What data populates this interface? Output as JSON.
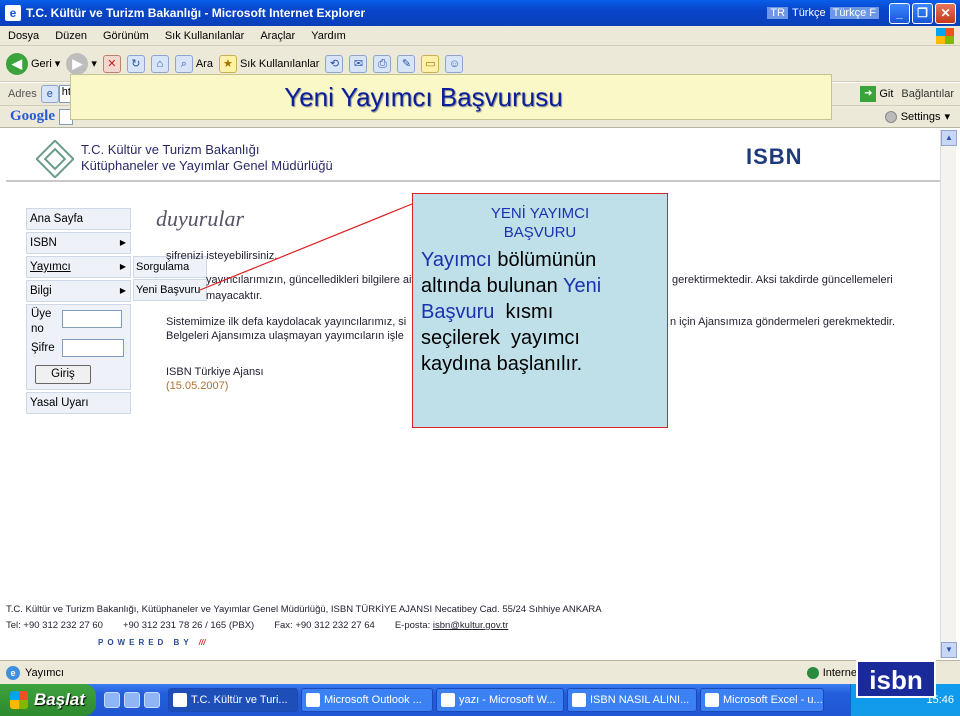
{
  "window": {
    "title": "T.C. Kültür ve Turizm Bakanlığı - Microsoft Internet Explorer",
    "lang_code": "TR",
    "lang_name": "Türkçe",
    "lang_kb": "Türkçe F"
  },
  "menu": [
    "Dosya",
    "Düzen",
    "Görünüm",
    "Sık Kullanılanlar",
    "Araçlar",
    "Yardım"
  ],
  "toolbar": {
    "back": "Geri",
    "search": "Ara",
    "favorites": "Sık Kullanılanlar"
  },
  "address": {
    "label": "Adres",
    "value": "ht",
    "go": "Git",
    "links": "Bağlantılar"
  },
  "google": {
    "logo": "Google",
    "settings": "Settings"
  },
  "banner": {
    "title": "Yeni Yayımcı Başvurusu"
  },
  "site": {
    "ministry_line1": "T.C. Kültür ve Turizm Bakanlığı",
    "ministry_line2": "Kütüphaneler ve Yayımlar Genel Müdürlüğü",
    "isbn": "ISBN"
  },
  "nav": [
    {
      "label": "Ana Sayfa",
      "caret": ""
    },
    {
      "label": "ISBN",
      "caret": "▶"
    },
    {
      "label": "Yayımcı",
      "caret": "▶"
    },
    {
      "label": "Bilgi",
      "caret": "▶"
    }
  ],
  "login": {
    "user_label_1": "Üye",
    "user_label_2": "no",
    "pass_label": "Şifre",
    "button": "Giriş"
  },
  "legal": "Yasal Uyarı",
  "submenu": [
    "Sorgulama",
    "Yeni Başvuru"
  ],
  "duyurular": "duyurular",
  "main_lines": [
    "şifrenizi isteyebilirsiniz.",
    "yayıncılarımızın, güncelledikleri bilgilere ait",
    "mayacaktır.",
    "gerektirmektedir. Aksi takdirde güncellemeleri",
    "Sistemimize ilk defa kaydolacak yayıncılarımız, si",
    "Belgeleri Ajansımıza ulaşmayan yayımcıların işle",
    "n için Ajansımıza göndermeleri gerekmektedir.",
    "ISBN Türkiye Ajansı",
    "(15.05.2007)"
  ],
  "callout": {
    "heading_line1": "YENİ YAYIMCI",
    "heading_line2": "BAŞVURU",
    "body_1": "Yayımcı",
    "body_2": " bölümünün",
    "body_3": "altında bulunan ",
    "body_4": "Yeni",
    "body_5": "Başvuru",
    "body_6": "  kısmı",
    "body_7": "seçilerek  yayımcı",
    "body_8": "kaydına başlanılır."
  },
  "footer": {
    "line1": "T.C. Kültür ve Turizm Bakanlığı, Kütüphaneler ve Yayımlar Genel Müdürlüğü, ISBN TÜRKİYE AJANSI Necatibey Cad. 55/24 Sıhhiye ANKARA",
    "tel": "Tel: +90 312 232 27 60",
    "pbx": "+90 312 231 78 26 / 165 (PBX)",
    "fax": "Fax:  +90 312 232 27 64",
    "email_label": "E-posta:",
    "email": "isbn@kultur.gov.tr",
    "powered": "POWERED BY",
    "powered_mark": "///"
  },
  "status": {
    "text": "Yayımcı",
    "zone": "Internet"
  },
  "taskbar": {
    "start": "Başlat",
    "tasks": [
      "T.C. Kültür ve Turi...",
      "Microsoft Outlook ...",
      "yazı - Microsoft W...",
      "ISBN NASIL ALINI...",
      "Microsoft Excel - u..."
    ],
    "clock": "15:46"
  },
  "logo_text": "isbn"
}
